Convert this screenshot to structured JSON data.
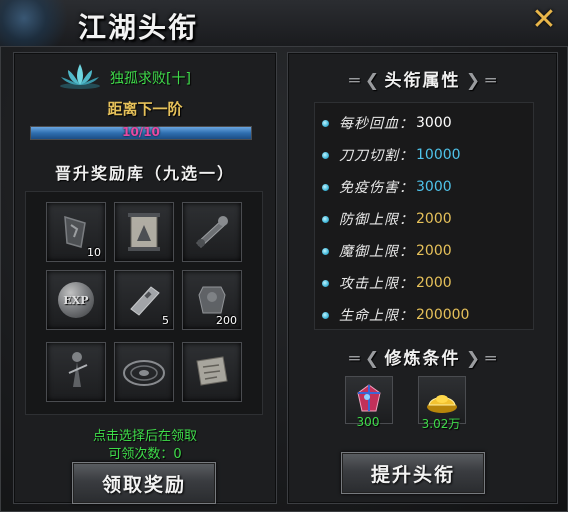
{
  "window": {
    "title": "江湖头衔",
    "close_icon": "close-x-icon"
  },
  "current_rank": {
    "name": "独孤求败[十]",
    "next_rank_label": "距离下一阶"
  },
  "progress": {
    "text": "10/10",
    "current": 10,
    "max": 10
  },
  "reward_pool": {
    "heading": "晋升奖励库（九选一）",
    "items": [
      {
        "icon": "rune-stone-icon",
        "qty": "10"
      },
      {
        "icon": "scroll-painting-icon",
        "qty": ""
      },
      {
        "icon": "cannon-icon",
        "qty": ""
      },
      {
        "icon": "exp-orb-icon",
        "qty": "",
        "label": "EXP"
      },
      {
        "icon": "silver-ingot-icon",
        "qty": "5"
      },
      {
        "icon": "armor-icon",
        "qty": "200"
      },
      {
        "icon": "sword-figure-icon",
        "qty": ""
      },
      {
        "icon": "array-disc-icon",
        "qty": ""
      },
      {
        "icon": "map-scroll-icon",
        "qty": ""
      }
    ],
    "hint": "点击选择后在领取",
    "claim_count_label": "可领次数：0",
    "claim_button": "领取奖励"
  },
  "attributes": {
    "heading": "头衔属性",
    "items": [
      {
        "label": "每秒回血：",
        "value": "3000",
        "color": "#ffffff"
      },
      {
        "label": "刀刀切割：",
        "value": "10000",
        "color": "#4fc3ea"
      },
      {
        "label": "免疫伤害：",
        "value": "3000",
        "color": "#4fc3ea"
      },
      {
        "label": "防御上限：",
        "value": "2000",
        "color": "#e6c15a"
      },
      {
        "label": "魔御上限：",
        "value": "2000",
        "color": "#e6c15a"
      },
      {
        "label": "攻击上限：",
        "value": "2000",
        "color": "#e6c15a"
      },
      {
        "label": "生命上限：",
        "value": "200000",
        "color": "#e6c15a"
      }
    ]
  },
  "requirements": {
    "heading": "修炼条件",
    "items": [
      {
        "icon": "gem-crystal-icon",
        "amount": "300"
      },
      {
        "icon": "gold-ingot-icon",
        "amount": "3.02万"
      }
    ],
    "upgrade_button": "提升头衔"
  },
  "colors": {
    "accent_green": "#3fdc4a",
    "accent_gold": "#e6c15a",
    "accent_blue": "#4fc3ea",
    "progress_text": "#e74aa3"
  }
}
